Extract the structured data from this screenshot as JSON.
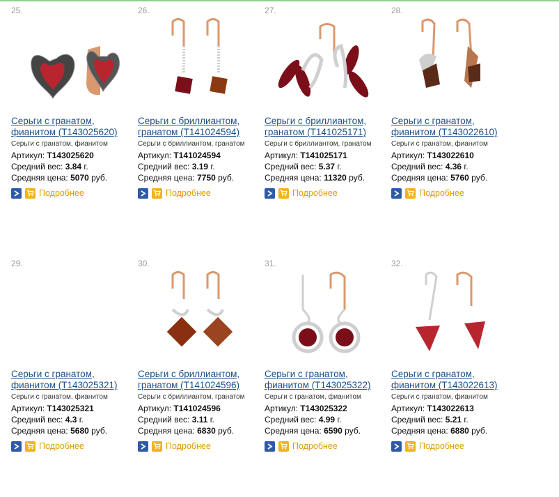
{
  "products": [
    {
      "num": "25.",
      "title": "Серьги с гранатом, фианитом (Т143025620)",
      "subtitle": "Серьги с гранатом, фианитом",
      "article_label": "Артикул:",
      "article": "Т143025620",
      "weight_label": "Средний вес:",
      "weight": "3.84",
      "weight_unit": "г.",
      "price_label": "Средняя цена:",
      "price": "5070",
      "price_unit": "руб.",
      "more": "Подробнее",
      "image": "heart-garnet-earrings-photo",
      "visible_image": true
    },
    {
      "num": "26.",
      "title": "Серьги с бриллиантом, гранатом (Т141024594)",
      "subtitle": "Серьги с бриллиантом, гранатом",
      "article_label": "Артикул:",
      "article": "Т141024594",
      "weight_label": "Средний вес:",
      "weight": "3.19",
      "weight_unit": "г.",
      "price_label": "Средняя цена:",
      "price": "7750",
      "price_unit": "руб.",
      "more": "Подробнее",
      "image": "drop-square-garnet-earrings-photo",
      "visible_image": true
    },
    {
      "num": "27.",
      "title": "Серьги с бриллиантом, гранатом (Т141025171)",
      "subtitle": "Серьги с бриллиантом, гранатом",
      "article_label": "Артикул:",
      "article": "Т141025171",
      "weight_label": "Средний вес:",
      "weight": "5.37",
      "weight_unit": "г.",
      "price_label": "Средняя цена:",
      "price": "11320",
      "price_unit": "руб.",
      "more": "Подробнее",
      "image": "marquise-garnet-earrings-photo",
      "visible_image": true
    },
    {
      "num": "28.",
      "title": "Серьги с гранатом, фианитом (Т143022610)",
      "subtitle": "Серьги с гранатом, фианитом",
      "article_label": "Артикул:",
      "article": "Т143022610",
      "weight_label": "Средний вес:",
      "weight": "4.36",
      "weight_unit": "г.",
      "price_label": "Средняя цена:",
      "price": "5760",
      "price_unit": "руб.",
      "more": "Подробнее",
      "image": "trillion-smoky-earrings-photo",
      "visible_image": true
    },
    {
      "num": "29.",
      "title": "Серьги с гранатом, фианитом (Т143025321)",
      "subtitle": "Серьги с гранатом, фианитом",
      "article_label": "Артикул:",
      "article": "Т143025321",
      "weight_label": "Средний вес:",
      "weight": "4.3",
      "weight_unit": "г.",
      "price_label": "Средняя цена:",
      "price": "5680",
      "price_unit": "руб.",
      "more": "Подробнее",
      "image": "blank-image",
      "visible_image": false
    },
    {
      "num": "30.",
      "title": "Серьги с бриллиантом, гранатом (Т141024596)",
      "subtitle": "Серьги с бриллиантом, гранатом",
      "article_label": "Артикул:",
      "article": "Т141024596",
      "weight_label": "Средний вес:",
      "weight": "3.11",
      "weight_unit": "г.",
      "price_label": "Средняя цена:",
      "price": "6830",
      "price_unit": "руб.",
      "more": "Подробнее",
      "image": "square-garnet-drop-earrings-photo",
      "visible_image": true
    },
    {
      "num": "31.",
      "title": "Серьги с гранатом, фианитом (Т143025322)",
      "subtitle": "Серьги с гранатом, фианитом",
      "article_label": "Артикул:",
      "article": "Т143025322",
      "weight_label": "Средний вес:",
      "weight": "4.99",
      "weight_unit": "г.",
      "price_label": "Средняя цена:",
      "price": "6590",
      "price_unit": "руб.",
      "more": "Подробнее",
      "image": "round-garnet-halo-drop-earrings-photo",
      "visible_image": true
    },
    {
      "num": "32.",
      "title": "Серьги с гранатом, фианитом (Т143022613)",
      "subtitle": "Серьги с гранатом, фианитом",
      "article_label": "Артикул:",
      "article": "Т143022613",
      "weight_label": "Средний вес:",
      "weight": "5.21",
      "weight_unit": "г.",
      "price_label": "Средняя цена:",
      "price": "6880",
      "price_unit": "руб.",
      "more": "Подробнее",
      "image": "trillion-garnet-drop-earrings-photo",
      "visible_image": true
    }
  ],
  "colors": {
    "link": "#1a4f8a",
    "more": "#e19a08",
    "arrow_button": "#2f5aa8",
    "cart_button": "#f2b321",
    "topline": "#8fcf8a"
  },
  "icons": {
    "arrow": "arrow-right-icon",
    "cart": "cart-icon"
  }
}
